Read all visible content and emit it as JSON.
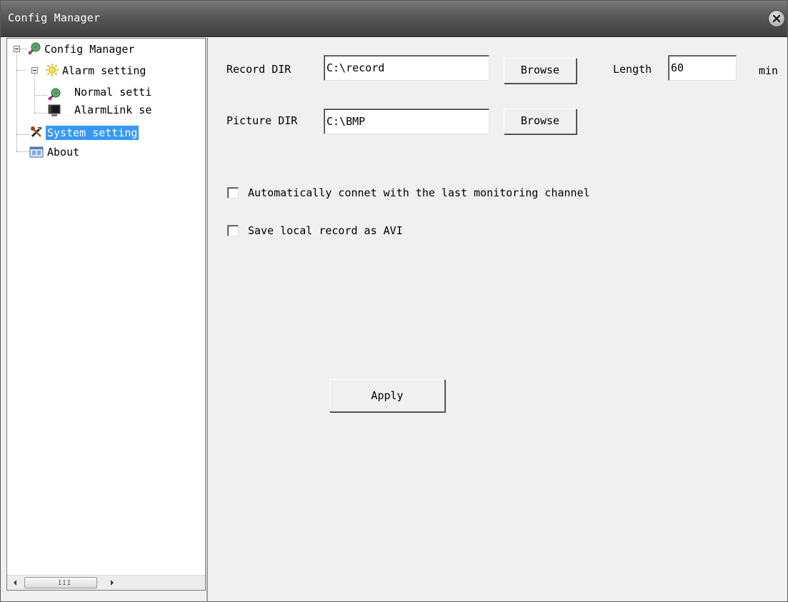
{
  "window": {
    "title": "Config Manager"
  },
  "tree": {
    "items": [
      {
        "label": "Config Manager",
        "icon": "config-gear-icon"
      },
      {
        "label": "Alarm setting",
        "icon": "sun-alarm-icon"
      },
      {
        "label": "Normal setti",
        "icon": "config-gear-icon"
      },
      {
        "label": "AlarmLink se",
        "icon": "monitor-icon"
      },
      {
        "label": "System setting",
        "icon": "tools-icon",
        "selected": true
      },
      {
        "label": "About",
        "icon": "about-window-icon"
      }
    ]
  },
  "form": {
    "record_dir_label": "Record DIR",
    "record_dir_value": "C:\\record",
    "browse_label": "Browse",
    "length_label": "Length",
    "length_value": "60",
    "min_label": "min",
    "picture_dir_label": "Picture DIR",
    "picture_dir_value": "C:\\BMP",
    "auto_connect_label": "Automatically connet with the last monitoring channel",
    "auto_connect_checked": false,
    "save_avi_label": "Save local record as AVI",
    "save_avi_checked": false,
    "apply_label": "Apply"
  },
  "scrollbar": {
    "grip": "III"
  },
  "colors": {
    "titlebar": "#575757",
    "selection": "#3399ff",
    "background": "#f0f0f0"
  }
}
